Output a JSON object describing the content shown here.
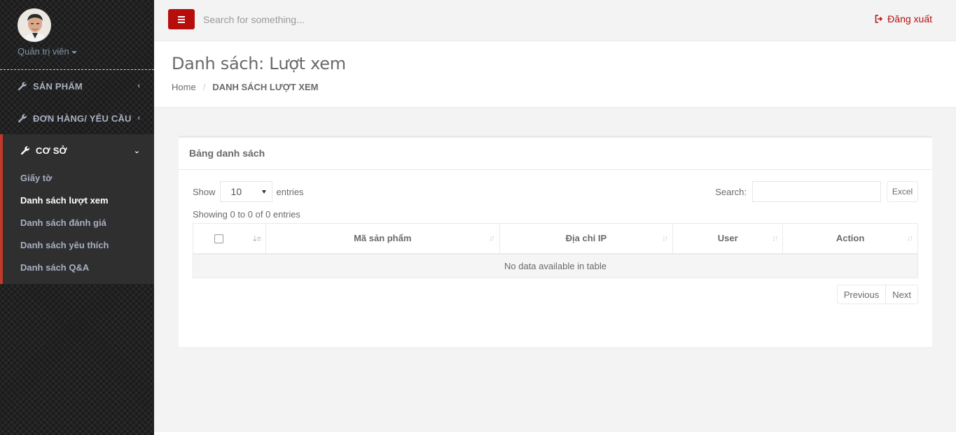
{
  "sidebar": {
    "profile_name": "Quản trị viên",
    "items": [
      {
        "label": "SẢN PHẨM"
      },
      {
        "label": "ĐƠN HÀNG/ YÊU CẦU"
      },
      {
        "label": "CƠ SỞ"
      }
    ],
    "sub_items": [
      {
        "label": "Giấy tờ"
      },
      {
        "label": "Danh sách lượt xem"
      },
      {
        "label": "Danh sách đánh giá"
      },
      {
        "label": "Danh sách yêu thích"
      },
      {
        "label": "Danh sách Q&A"
      }
    ]
  },
  "topbar": {
    "search_placeholder": "Search for something...",
    "logout_label": "Đăng xuất"
  },
  "heading": {
    "title": "Danh sách: Lượt xem",
    "breadcrumb_home": "Home",
    "breadcrumb_sep": "/",
    "breadcrumb_active": "DANH SÁCH LƯỢT XEM"
  },
  "panel": {
    "title": "Bảng danh sách",
    "show_label": "Show",
    "entries_value": "10",
    "entries_label": "entries",
    "search_label": "Search:",
    "excel_label": "Excel",
    "info": "Showing 0 to 0 of 0 entries",
    "columns": [
      "Mã sản phẩm",
      "Địa chỉ IP",
      "User",
      "Action"
    ],
    "empty_message": "No data available in table",
    "prev_label": "Previous",
    "next_label": "Next"
  },
  "colors": {
    "accent": "#b70d0d",
    "sidebar_bg": "#1c1c1c",
    "active_border": "#c0392b"
  }
}
